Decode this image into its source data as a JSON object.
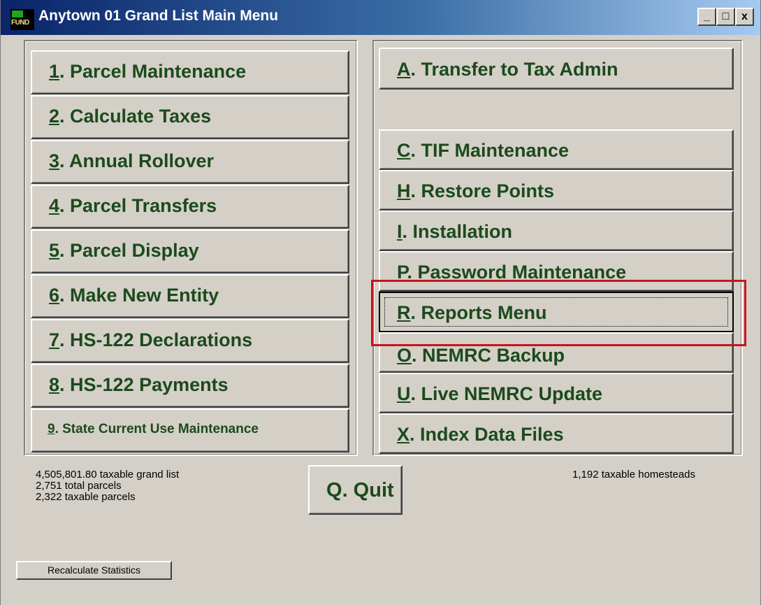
{
  "window": {
    "title": "Anytown 01 Grand List Main Menu",
    "icon_top": "NEMRC",
    "icon_text": "FUND",
    "controls": {
      "minimize": "_",
      "maximize": "□",
      "close": "x"
    }
  },
  "left_menu": [
    {
      "key": "1",
      "label": ". Parcel Maintenance"
    },
    {
      "key": "2",
      "label": ". Calculate Taxes"
    },
    {
      "key": "3",
      "label": ". Annual Rollover"
    },
    {
      "key": "4",
      "label": ". Parcel Transfers"
    },
    {
      "key": "5",
      "label": ". Parcel Display"
    },
    {
      "key": "6",
      "label": ". Make New Entity"
    },
    {
      "key": "7",
      "label": ". HS-122 Declarations"
    },
    {
      "key": "8",
      "label": ". HS-122 Payments"
    },
    {
      "key": "9",
      "label": ". State Current Use Maintenance"
    }
  ],
  "right_menu": [
    {
      "key": "A",
      "label": ". Transfer to Tax Admin"
    },
    {
      "key": "C",
      "label": ". TIF Maintenance"
    },
    {
      "key": "H",
      "label": ". Restore Points"
    },
    {
      "key": "I",
      "label": ".  Installation"
    },
    {
      "key": "P",
      "label": ".  Password Maintenance"
    },
    {
      "key": "R",
      "label": ".  Reports Menu"
    },
    {
      "key": "O",
      "label": ". NEMRC Backup"
    },
    {
      "key": "U",
      "label": ". Live NEMRC Update"
    },
    {
      "key": "X",
      "label": ".  Index Data Files"
    }
  ],
  "stats": {
    "grand_list": "4,505,801.80 taxable grand list",
    "total_parcels": "2,751 total parcels",
    "taxable_parcels": "2,322 taxable parcels",
    "homesteads": "1,192 taxable homesteads"
  },
  "quit": {
    "key": "Q",
    "label": ".  Quit"
  },
  "recalc_label": "Recalculate Statistics",
  "colors": {
    "button_text": "#1c4a1c",
    "highlight": "#c4161c",
    "face": "#d4d0c8"
  }
}
